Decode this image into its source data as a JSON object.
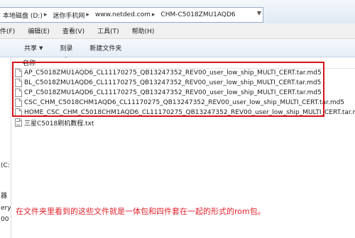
{
  "address": {
    "crumbs": [
      "本地磁盘 (D:)",
      "迷你手机网",
      "www.netded.com",
      "CHM-C5018ZMU1AQD6"
    ]
  },
  "menu": {
    "items": [
      "件(F)",
      "编辑(E)",
      "查看(V)",
      "工具(T)",
      "帮助(H)"
    ]
  },
  "toolbar": {
    "share_label": "共享",
    "burn_label": "刻录",
    "new_folder_label": "新建文件夹"
  },
  "list": {
    "column_header": "名称",
    "files": [
      {
        "name": "AP_C5018ZMU1AQD6_CL11170275_QB13247352_REV00_user_low_ship_MULTI_CERT.tar.md5",
        "type": "md5"
      },
      {
        "name": "BL_C5018ZMU1AQD6_CL11170275_QB13247352_REV00_user_low_ship_MULTI_CERT.tar.md5",
        "type": "md5"
      },
      {
        "name": "CP_C5018ZMU1AQD6_CL11170275_QB13247352_REV00_user_low_ship_MULTI_CERT.tar.md5",
        "type": "md5"
      },
      {
        "name": "CSC_CHM_C5018CHM1AQD6_CL11170275_QB13247352_REV00_user_low_ship_MULTI_CERT.tar.md5",
        "type": "md5"
      },
      {
        "name": "HOME_CSC_CHM_C5018CHM1AQD6_CL11170275_QB13247352_REV00_user_low_ship_MULTI_CERT.tar.md5",
        "type": "md5"
      },
      {
        "name": "三星C5018刷机教程.txt",
        "type": "txt"
      }
    ]
  },
  "nav": {
    "fragments": [
      "(C:",
      "器",
      "ery",
      "00"
    ]
  },
  "caption": "在文件夹里看到的这些文件就是一体包和四件套在一起的形式的rom包。",
  "colors": {
    "highlight": "#d8121a",
    "caption": "#e0212b"
  }
}
